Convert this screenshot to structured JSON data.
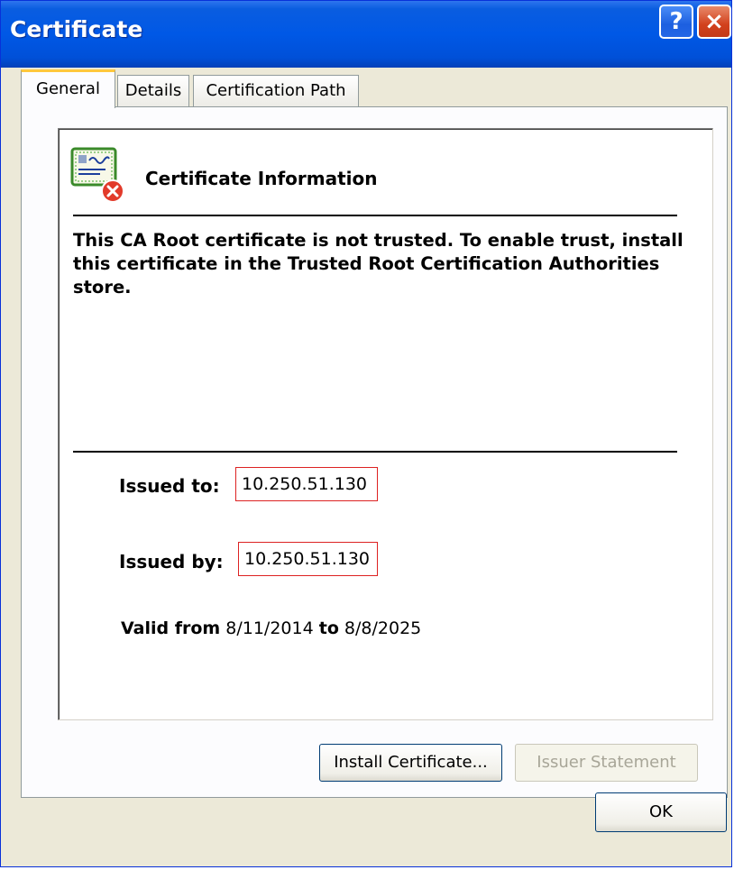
{
  "window": {
    "title": "Certificate",
    "help_label": "?",
    "close_label": "×"
  },
  "tabs": [
    {
      "label": "General",
      "active": true
    },
    {
      "label": "Details",
      "active": false
    },
    {
      "label": "Certification Path",
      "active": false
    }
  ],
  "general": {
    "info_title": "Certificate Information",
    "message": "This CA Root certificate is not trusted. To enable trust, install this certificate in the Trusted Root Certification Authorities store.",
    "issued_to_label": "Issued to:",
    "issued_to_value": "10.250.51.130",
    "issued_by_label": "Issued by:",
    "issued_by_value": "10.250.51.130",
    "valid_from_label": "Valid from",
    "valid_from_value": "8/11/2014",
    "valid_to_label": "to",
    "valid_to_value": "8/8/2025"
  },
  "buttons": {
    "install": "Install Certificate...",
    "issuer_statement": "Issuer Statement",
    "ok": "OK"
  },
  "icons": {
    "certificate": "certificate-error-icon",
    "help": "help-icon",
    "close": "close-icon"
  },
  "colors": {
    "titlebar": "#0058e6",
    "highlight_box": "#dd2222",
    "active_tab_accent": "#ffc83c"
  }
}
